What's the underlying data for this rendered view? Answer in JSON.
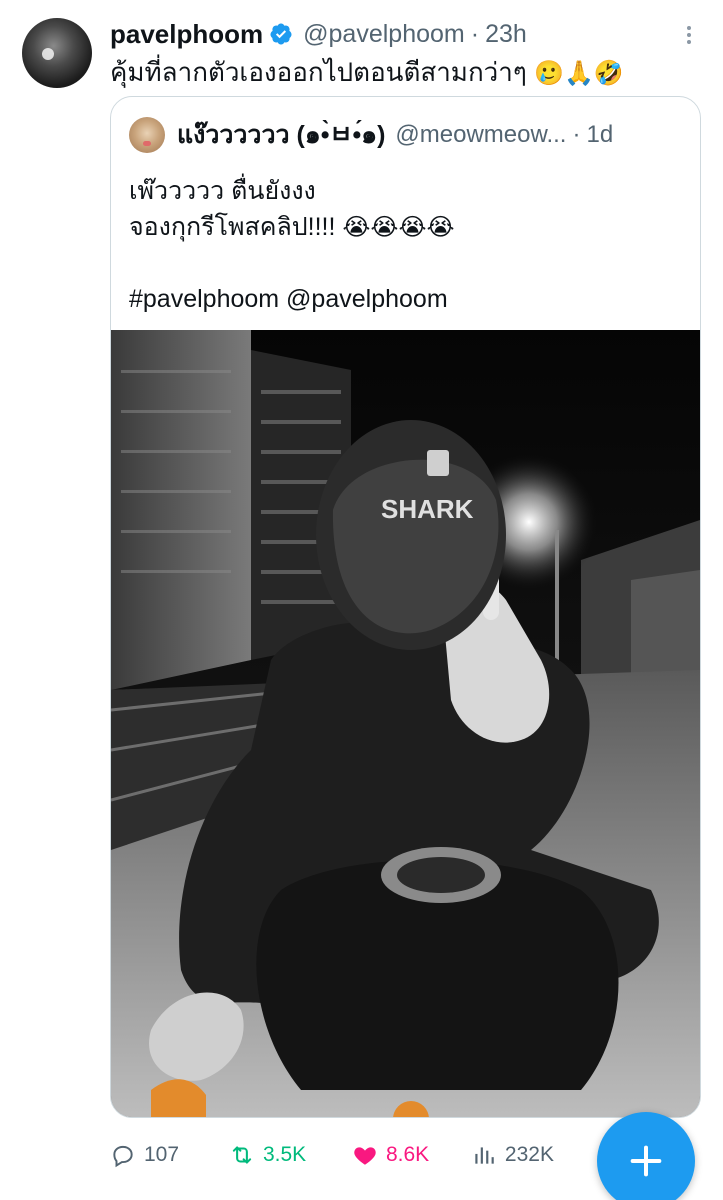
{
  "tweet": {
    "display_name": "pavelphoom",
    "handle": "@pavelphoom",
    "separator": "·",
    "time": "23h",
    "text": "คุ้มที่ลากตัวเองออกไปตอนตีสามกว่าๆ",
    "emojis": "🥲🙏🤣",
    "verified_color": "#1d9bf0"
  },
  "quoted": {
    "display_name": "แง๊วววววว (๑•̀ㅂ•́๑)",
    "handle": "@meowmeow...",
    "separator": "·",
    "time": "1d",
    "line1": "เพ๊ววววว ตื่นยังงง",
    "line2": "จองกุกรีโพสคลิป!!!!",
    "line2_emojis": "😭😭😭😭",
    "line3": "#pavelphoom @pavelphoom",
    "media": {
      "description_icon": "motorcycle-selfie-photo",
      "helmet_text": "SHARK"
    }
  },
  "actions": {
    "replies": "107",
    "reposts": "3.5K",
    "likes": "8.6K",
    "views": "232K"
  },
  "colors": {
    "accent": "#1d9bf0",
    "repost": "#00ba7c",
    "like": "#f91880",
    "muted": "#536471"
  }
}
